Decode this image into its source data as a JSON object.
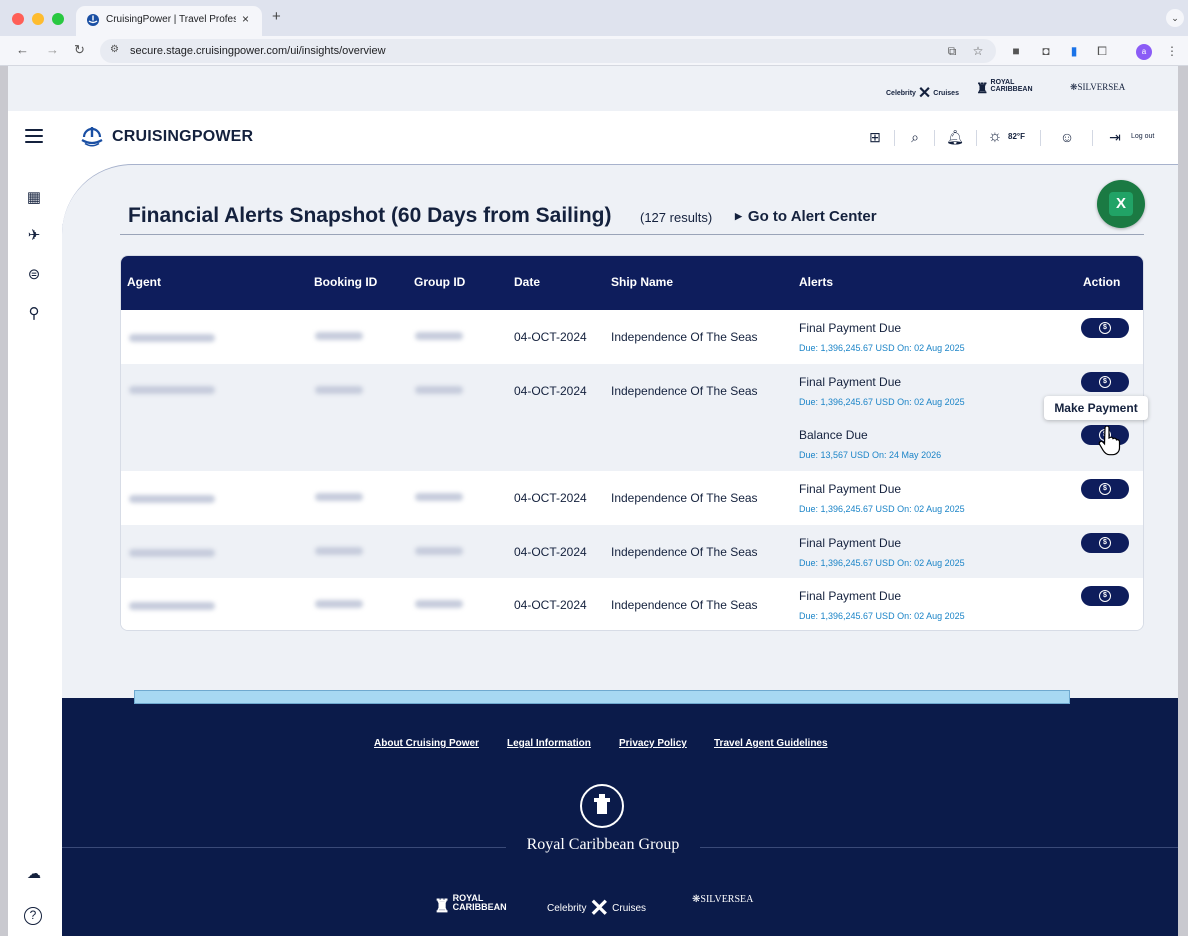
{
  "browser": {
    "tab_title": "CruisingPower | Travel Profes",
    "tab_close": "×",
    "new_tab": "+",
    "url": "secure.stage.cruisingpower.com/ui/insights/overview",
    "profile_initial": "a"
  },
  "brands_top": {
    "celebrity_left": "Celebrity",
    "celebrity_right": "Cruises",
    "royal_line1": "ROYAL",
    "royal_line2": "CARIBBEAN",
    "silversea": "SILVERSEA"
  },
  "header": {
    "logo_text": "CRUISINGPOWER",
    "temperature": "82°F",
    "logout_label": "Log out"
  },
  "page": {
    "title": "Financial Alerts Snapshot (60 Days from Sailing)",
    "results": "(127 results)",
    "goto_label": "Go to Alert Center",
    "excel_label": "X"
  },
  "table": {
    "columns": [
      "Agent",
      "Booking ID",
      "Group ID",
      "Date",
      "Ship Name",
      "Alerts",
      "Action"
    ],
    "rows": [
      {
        "date": "04-OCT-2024",
        "ship": "Independence Of The Seas",
        "alerts": [
          {
            "title": "Final Payment Due",
            "due": "Due: 1,396,245.67 USD On: 02 Aug 2025"
          }
        ]
      },
      {
        "date": "04-OCT-2024",
        "ship": "Independence Of The Seas",
        "alerts": [
          {
            "title": "Final Payment Due",
            "due": "Due: 1,396,245.67 USD On: 02 Aug 2025"
          },
          {
            "title": "Balance Due",
            "due": "Due: 13,567 USD On: 24 May 2026"
          }
        ]
      },
      {
        "date": "04-OCT-2024",
        "ship": "Independence Of The Seas",
        "alerts": [
          {
            "title": "Final Payment Due",
            "due": "Due: 1,396,245.67 USD On: 02 Aug 2025"
          }
        ]
      },
      {
        "date": "04-OCT-2024",
        "ship": "Independence Of The Seas",
        "alerts": [
          {
            "title": "Final Payment Due",
            "due": "Due: 1,396,245.67 USD On: 02 Aug 2025"
          }
        ]
      },
      {
        "date": "04-OCT-2024",
        "ship": "Independence Of The Seas",
        "alerts": [
          {
            "title": "Final Payment Due",
            "due": "Due: 1,396,245.67 USD On: 02 Aug 2025"
          }
        ]
      }
    ],
    "tooltip": "Make Payment"
  },
  "footer": {
    "links": [
      "About Cruising Power",
      "Legal Information",
      "Privacy Policy",
      "Travel Agent Guidelines"
    ],
    "group_name": "Royal Caribbean Group",
    "royal_line1": "ROYAL",
    "royal_line2": "CARIBBEAN",
    "celebrity_left": "Celebrity",
    "celebrity_right": "Cruises",
    "silversea": "SILVERSEA"
  },
  "colors": {
    "navy": "#0e1d5c",
    "footer": "#0b1b4a",
    "link_blue": "#1b84c7",
    "excel_green": "#1b7a43"
  }
}
